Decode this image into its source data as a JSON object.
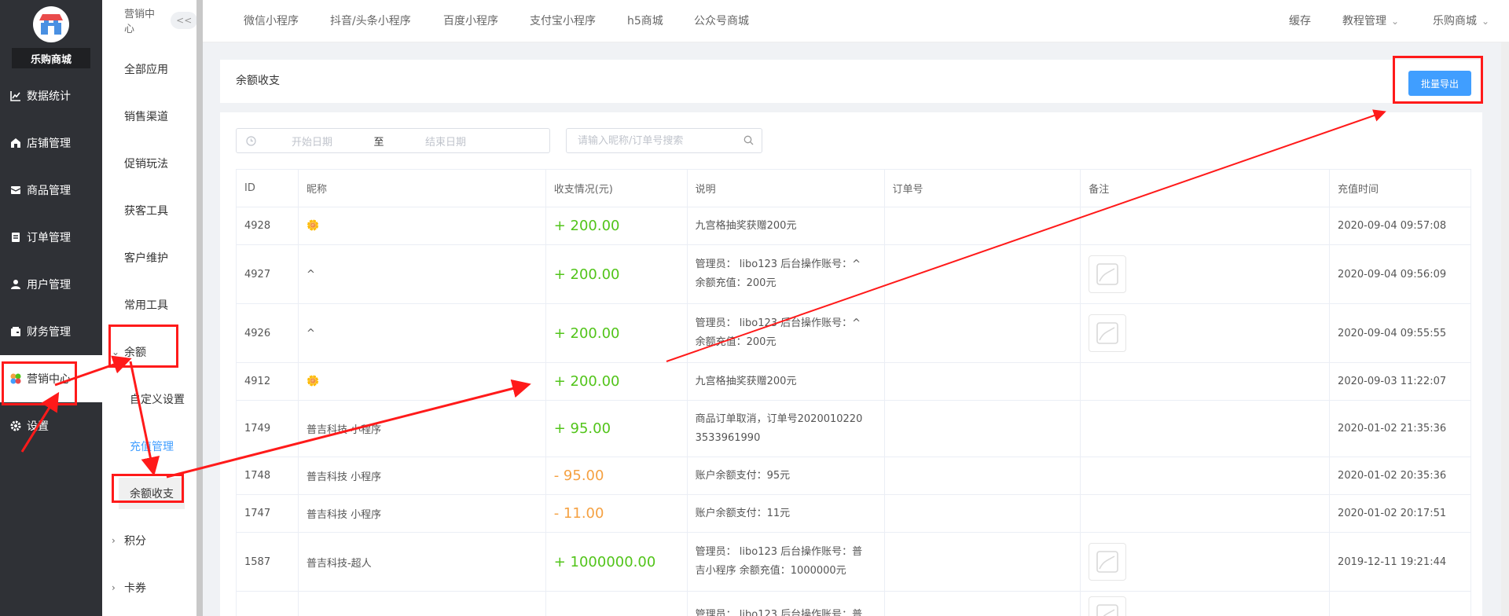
{
  "sidebar": {
    "shop_name": "乐购商城",
    "items": [
      {
        "label": "数据统计",
        "icon": "chart-line-icon"
      },
      {
        "label": "店铺管理",
        "icon": "store-icon"
      },
      {
        "label": "商品管理",
        "icon": "box-icon"
      },
      {
        "label": "订单管理",
        "icon": "order-icon"
      },
      {
        "label": "用户管理",
        "icon": "user-icon"
      },
      {
        "label": "财务管理",
        "icon": "wallet-icon"
      },
      {
        "label": "营销中心",
        "icon": "marketing-icon"
      },
      {
        "label": "设置",
        "icon": "gear-icon"
      }
    ]
  },
  "subbar": {
    "title": "营销中心",
    "collapse": "<<",
    "items": [
      {
        "label": "全部应用"
      },
      {
        "label": "销售渠道"
      },
      {
        "label": "促销玩法"
      },
      {
        "label": "获客工具"
      },
      {
        "label": "客户维护"
      },
      {
        "label": "常用工具"
      }
    ],
    "group_balance": "余额",
    "balance_children": [
      "自定义设置",
      "充值管理",
      "余额收支"
    ],
    "group_points": "积分",
    "group_coupons": "卡券"
  },
  "topnav": {
    "tabs": [
      "微信小程序",
      "抖音/头条小程序",
      "百度小程序",
      "支付宝小程序",
      "h5商城",
      "公众号商城"
    ],
    "right": [
      "缓存",
      "教程管理",
      "乐购商城"
    ]
  },
  "page": {
    "title": "余额收支",
    "export_label": "批量导出"
  },
  "filters": {
    "start_placeholder": "开始日期",
    "sep": "至",
    "end_placeholder": "结束日期",
    "search_placeholder": "请输入昵称/订单号搜索"
  },
  "table": {
    "headers": [
      "ID",
      "昵称",
      "收支情况(元)",
      "说明",
      "订单号",
      "备注",
      "充值时间"
    ],
    "rows": [
      {
        "id": "4928",
        "nick": "🌼",
        "amount": "+ 200.00",
        "type": "pos",
        "desc1": "九宫格抽奖获赠200元",
        "desc2": "",
        "order": "",
        "img": false,
        "time": "2020-09-04 09:57:08"
      },
      {
        "id": "4927",
        "nick": "^",
        "amount": "+ 200.00",
        "type": "pos",
        "desc1": "管理员： libo123 后台操作账号：^",
        "desc2": "余额充值：200元",
        "order": "",
        "img": true,
        "time": "2020-09-04 09:56:09"
      },
      {
        "id": "4926",
        "nick": "^",
        "amount": "+ 200.00",
        "type": "pos",
        "desc1": "管理员： libo123 后台操作账号：^",
        "desc2": "余额充值：200元",
        "order": "",
        "img": true,
        "time": "2020-09-04 09:55:55"
      },
      {
        "id": "4912",
        "nick": "🌼",
        "amount": "+ 200.00",
        "type": "pos",
        "desc1": "九宫格抽奖获赠200元",
        "desc2": "",
        "order": "",
        "img": false,
        "time": "2020-09-03 11:22:07"
      },
      {
        "id": "1749",
        "nick": "普吉科技 小程序",
        "amount": "+ 95.00",
        "type": "pos",
        "desc1": "商品订单取消，订单号2020010220",
        "desc2": "3533961990",
        "order": "",
        "img": false,
        "time": "2020-01-02 21:35:36"
      },
      {
        "id": "1748",
        "nick": "普吉科技 小程序",
        "amount": "- 95.00",
        "type": "neg",
        "desc1": "账户余额支付：95元",
        "desc2": "",
        "order": "",
        "img": false,
        "time": "2020-01-02 20:35:36"
      },
      {
        "id": "1747",
        "nick": "普吉科技 小程序",
        "amount": "- 11.00",
        "type": "neg",
        "desc1": "账户余额支付：11元",
        "desc2": "",
        "order": "",
        "img": false,
        "time": "2020-01-02 20:17:51"
      },
      {
        "id": "1587",
        "nick": "普吉科技-超人",
        "amount": "+ 1000000.00",
        "type": "pos",
        "desc1": "管理员： libo123 后台操作账号：普",
        "desc2": "吉小程序 余额充值：1000000元",
        "order": "",
        "img": true,
        "time": "2019-12-11 19:21:44"
      },
      {
        "id": "",
        "nick": "",
        "amount": "",
        "type": "neg",
        "desc1": "管理员： libo123 后台操作账号：普",
        "desc2": "",
        "order": "",
        "img": true,
        "time": ""
      }
    ]
  },
  "colors": {
    "accent": "#409eff",
    "positive": "#52c41a",
    "negative": "#f5a142",
    "annotation": "#ff1a1a",
    "sidebar_bg": "#2f3136"
  }
}
